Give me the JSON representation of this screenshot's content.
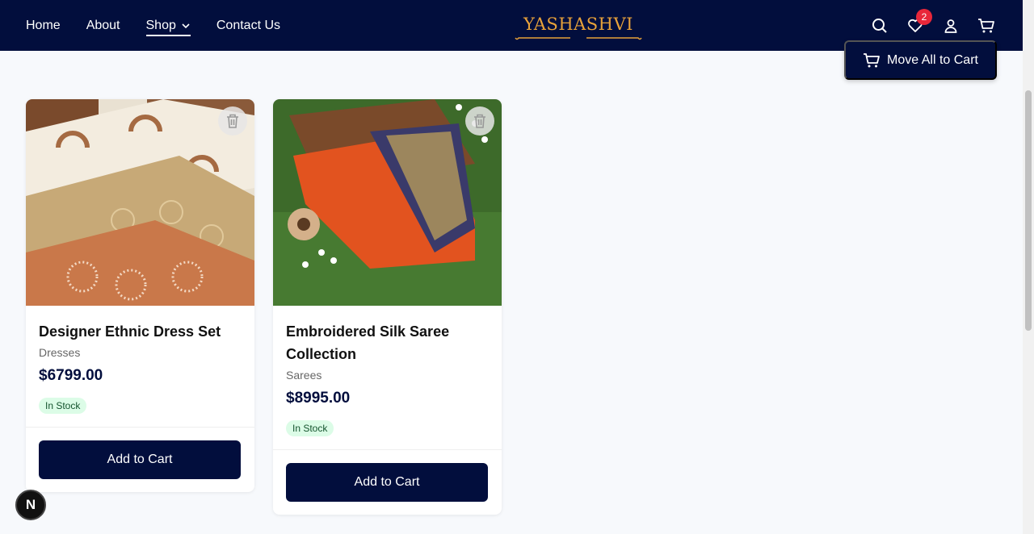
{
  "nav": {
    "items": [
      {
        "label": "Home"
      },
      {
        "label": "About"
      },
      {
        "label": "Shop"
      },
      {
        "label": "Contact Us"
      }
    ]
  },
  "brand": {
    "name": "YASHASHVI"
  },
  "header_icons": {
    "wishlist_count": "2"
  },
  "actions": {
    "move_all": "Move All to Cart"
  },
  "products": [
    {
      "title": "Designer Ethnic Dress Set",
      "category": "Dresses",
      "price": "$6799.00",
      "stock": "In Stock",
      "button": "Add to Cart"
    },
    {
      "title": "Embroidered Silk Saree Collection",
      "category": "Sarees",
      "price": "$8995.00",
      "stock": "In Stock",
      "button": "Add to Cart"
    }
  ],
  "dev_badge": "N",
  "colors": {
    "navy": "#020e3d",
    "gold": "#e8a23a",
    "badge_red": "#e8273a",
    "stock_bg": "#dcfce7"
  }
}
